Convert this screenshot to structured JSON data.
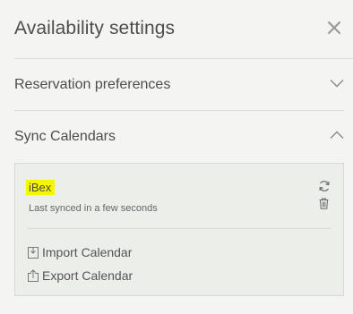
{
  "header": {
    "title": "Availability settings"
  },
  "icons": {
    "close": "close-icon",
    "chevron_down": "chevron-down-icon",
    "chevron_up": "chevron-up-icon",
    "refresh": "refresh-icon",
    "trash": "trash-icon",
    "import": "import-icon",
    "export": "export-icon"
  },
  "sections": [
    {
      "label": "Reservation preferences",
      "expanded": false
    },
    {
      "label": "Sync Calendars",
      "expanded": true
    }
  ],
  "sync": {
    "calendar_name": "iBex",
    "status": "Last synced in a few seconds",
    "import_label": "Import Calendar",
    "export_label": "Export Calendar"
  },
  "colors": {
    "highlight": "#f6f600",
    "background": "#f4f4f3",
    "box_background": "#eceeea"
  }
}
